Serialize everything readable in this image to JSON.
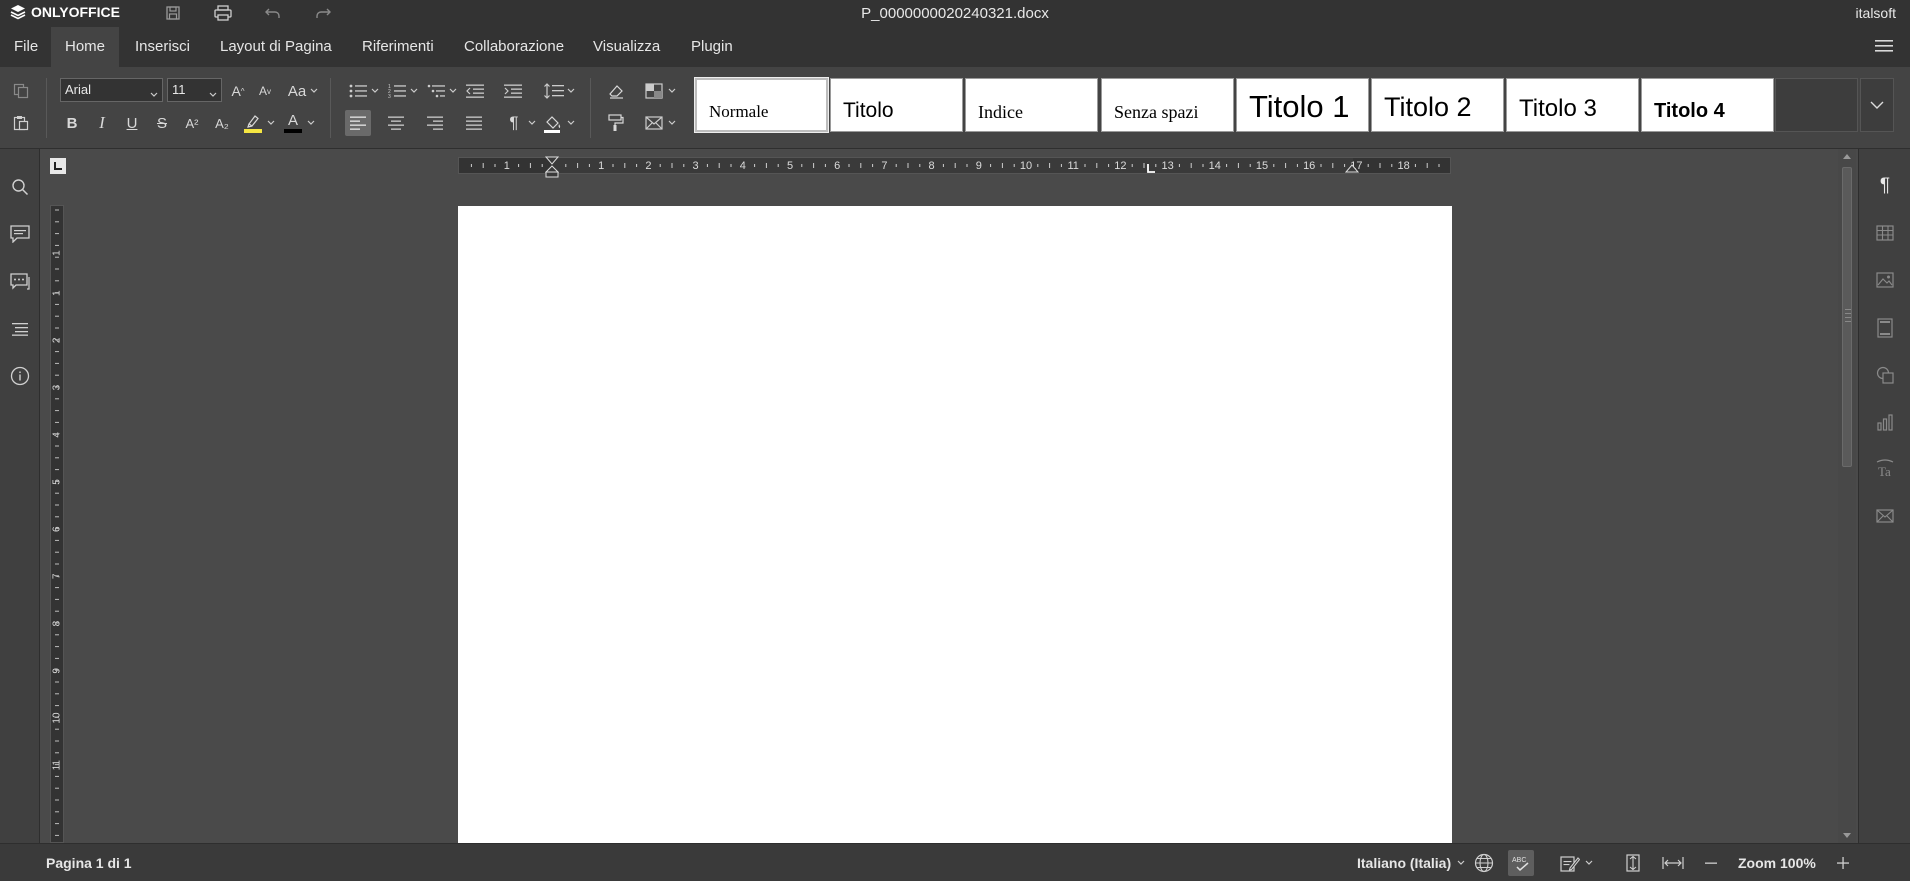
{
  "app": {
    "brand": "ONLYOFFICE",
    "document_title": "P_0000000020240321.docx",
    "user": "italsoft"
  },
  "menu": {
    "tabs": [
      {
        "label": "File"
      },
      {
        "label": "Home"
      },
      {
        "label": "Inserisci"
      },
      {
        "label": "Layout di Pagina"
      },
      {
        "label": "Riferimenti"
      },
      {
        "label": "Collaborazione"
      },
      {
        "label": "Visualizza"
      },
      {
        "label": "Plugin"
      }
    ],
    "active_tab": "Home"
  },
  "toolbar": {
    "font_name": "Arial",
    "font_size": "11",
    "bold": "B",
    "italic": "I",
    "underline": "U",
    "strike": "S",
    "superscript": "A²",
    "subscript": "A₂",
    "grow": "A",
    "shrink": "A",
    "change_case": "Aa",
    "font_color_label": "A",
    "highlight_color": "#f5e642",
    "font_color": "#000000",
    "pilcrow": "¶"
  },
  "styles": [
    {
      "label": "Normale"
    },
    {
      "label": "Titolo"
    },
    {
      "label": "Indice"
    },
    {
      "label": "Senza spazi"
    },
    {
      "label": "Titolo 1"
    },
    {
      "label": "Titolo 2"
    },
    {
      "label": "Titolo 3"
    },
    {
      "label": "Titolo 4"
    }
  ],
  "ruler": {
    "h_labels": [
      "1",
      "1",
      "2",
      "3",
      "4",
      "5",
      "6",
      "7",
      "8",
      "9",
      "10",
      "11",
      "12",
      "13",
      "14",
      "15",
      "16",
      "17",
      "18"
    ],
    "v_labels": [
      "1",
      "1",
      "2",
      "3",
      "4",
      "5",
      "6",
      "7",
      "8",
      "9",
      "10",
      "11"
    ]
  },
  "status": {
    "page_info": "Pagina 1 di 1",
    "language": "Italiano (Italia)",
    "zoom": "Zoom 100%"
  },
  "colors": {
    "title_bg": "#333333",
    "toolbar_bg": "#444444",
    "canvas_bg": "#4a4a4a",
    "page_bg": "#ffffff"
  }
}
